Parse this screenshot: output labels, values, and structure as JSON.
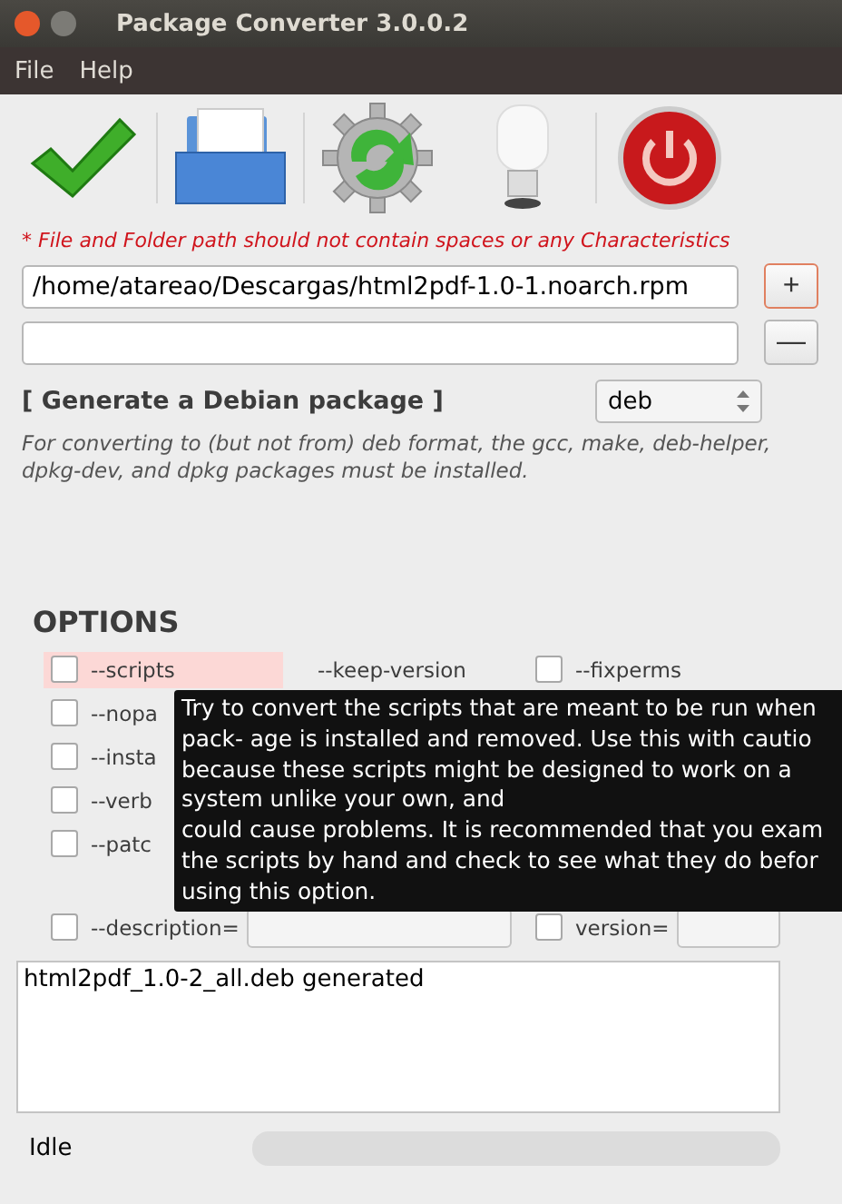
{
  "window": {
    "title": "Package Converter 3.0.0.2"
  },
  "menu": [
    "File",
    "Help"
  ],
  "toolbar": [
    {
      "kind": "check"
    },
    {
      "kind": "tray"
    },
    {
      "kind": "gear"
    },
    {
      "kind": "bulb"
    },
    {
      "kind": "power"
    }
  ],
  "warning": "* File and Folder path should not contain spaces or any Characteristics",
  "source_path": {
    "value": "/home/atareao/Descargas/html2pdf-1.0-1.noarch.rpm",
    "button": "+"
  },
  "second_path": {
    "button": "—"
  },
  "target": {
    "label": "[ Generate a Debian package ]",
    "format": "deb"
  },
  "help": "For converting to (but not from) deb format, the gcc, make, deb-helper, dpkg-dev, and dpkg packages must be installed.",
  "options": {
    "title": "OPTIONS",
    "rows": [
      [
        {
          "kind": "check",
          "label": "--scripts",
          "checked": false,
          "selected": true
        },
        {
          "kind": "text",
          "label": "--keep-version"
        },
        {
          "kind": "check",
          "label": "--fixperms",
          "checked": false,
          "selected": false
        }
      ],
      [
        {
          "kind": "check",
          "label": "--nopa",
          "checked": false,
          "selected": false
        }
      ],
      [
        {
          "kind": "check",
          "label": "--insta",
          "checked": false,
          "selected": false
        }
      ],
      [
        {
          "kind": "check",
          "label": "--verb",
          "checked": false,
          "selected": false
        }
      ],
      [
        {
          "kind": "check",
          "label": "--patc",
          "checked": false,
          "selected": false
        }
      ]
    ],
    "entries": [
      {
        "label": "--description=",
        "checked": false,
        "selected": false
      },
      {
        "label": "version=",
        "checked": false,
        "selected": false
      }
    ]
  },
  "tooltip": [
    "Try to convert the scripts that are meant to be run when",
    "pack- age is installed and removed. Use this with cautio",
    "because these scripts might be designed to work on a",
    "system unlike your own, and",
    "could cause problems. It is recommended that you exam",
    "the scripts by hand and check to see what they do befor",
    "using this option."
  ],
  "log": "html2pdf_1.0-2_all.deb generated",
  "status": {
    "text": "Idle",
    "level": 0
  }
}
